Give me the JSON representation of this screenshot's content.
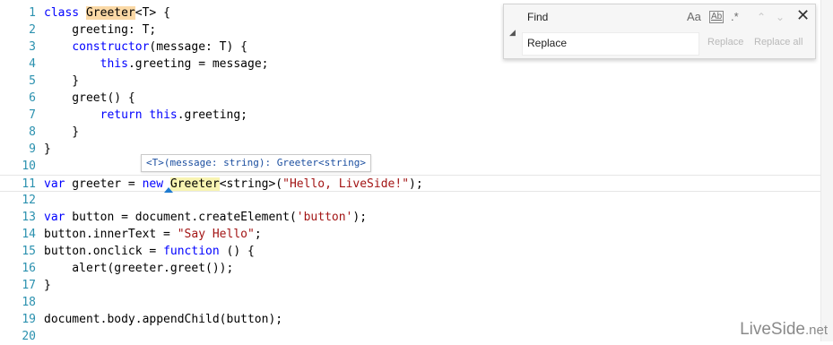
{
  "editor": {
    "lines": [
      {
        "n": "1",
        "segs": [
          {
            "t": "class ",
            "c": "kw"
          },
          {
            "t": "Greeter",
            "c": "hl-ref"
          },
          {
            "t": "<T> {",
            "c": ""
          }
        ]
      },
      {
        "n": "2",
        "segs": [
          {
            "t": "    greeting: T;",
            "c": ""
          }
        ]
      },
      {
        "n": "3",
        "segs": [
          {
            "t": "    ",
            "c": ""
          },
          {
            "t": "constructor",
            "c": "kw"
          },
          {
            "t": "(message: T) {",
            "c": ""
          }
        ]
      },
      {
        "n": "4",
        "segs": [
          {
            "t": "        ",
            "c": ""
          },
          {
            "t": "this",
            "c": "kw"
          },
          {
            "t": ".greeting = message;",
            "c": ""
          }
        ]
      },
      {
        "n": "5",
        "segs": [
          {
            "t": "    }",
            "c": ""
          }
        ]
      },
      {
        "n": "6",
        "segs": [
          {
            "t": "    greet() {",
            "c": ""
          }
        ]
      },
      {
        "n": "7",
        "segs": [
          {
            "t": "        ",
            "c": ""
          },
          {
            "t": "return",
            "c": "kw"
          },
          {
            "t": " ",
            "c": ""
          },
          {
            "t": "this",
            "c": "kw"
          },
          {
            "t": ".greeting;",
            "c": ""
          }
        ]
      },
      {
        "n": "8",
        "segs": [
          {
            "t": "    }",
            "c": ""
          }
        ]
      },
      {
        "n": "9",
        "segs": [
          {
            "t": "}",
            "c": ""
          }
        ]
      },
      {
        "n": "10",
        "segs": []
      },
      {
        "n": "11",
        "segs": [
          {
            "t": "var",
            "c": "kw"
          },
          {
            "t": " greeter = ",
            "c": ""
          },
          {
            "t": "new",
            "c": "kw"
          },
          {
            "t": " ",
            "c": ""
          },
          {
            "t": "Greeter",
            "c": "hl-sel"
          },
          {
            "t": "<string>(",
            "c": ""
          },
          {
            "t": "\"Hello, LiveSide!\"",
            "c": "str"
          },
          {
            "t": ");",
            "c": ""
          }
        ],
        "current": true
      },
      {
        "n": "12",
        "segs": []
      },
      {
        "n": "13",
        "segs": [
          {
            "t": "var",
            "c": "kw"
          },
          {
            "t": " button = document.createElement(",
            "c": ""
          },
          {
            "t": "'button'",
            "c": "str"
          },
          {
            "t": ");",
            "c": ""
          }
        ]
      },
      {
        "n": "14",
        "segs": [
          {
            "t": "button.innerText = ",
            "c": ""
          },
          {
            "t": "\"Say Hello\"",
            "c": "str"
          },
          {
            "t": ";",
            "c": ""
          }
        ]
      },
      {
        "n": "15",
        "segs": [
          {
            "t": "button.onclick = ",
            "c": ""
          },
          {
            "t": "function",
            "c": "kw"
          },
          {
            "t": " () {",
            "c": ""
          }
        ]
      },
      {
        "n": "16",
        "segs": [
          {
            "t": "    alert(greeter.greet());",
            "c": ""
          }
        ]
      },
      {
        "n": "17",
        "segs": [
          {
            "t": "}",
            "c": ""
          }
        ]
      },
      {
        "n": "18",
        "segs": []
      },
      {
        "n": "19",
        "segs": [
          {
            "t": "document.body.appendChild(button);",
            "c": ""
          }
        ]
      },
      {
        "n": "20",
        "segs": []
      }
    ]
  },
  "tooltip": {
    "text": "<T>(message: string): Greeter<string>"
  },
  "find": {
    "find_placeholder": "Find",
    "replace_placeholder": "Replace",
    "match_case_icon": "Aa",
    "whole_word_icon": "Ab",
    "regex_icon": ".*",
    "prev_icon": "^",
    "next_icon": "v",
    "close_icon": "x",
    "replace_label": "Replace",
    "replace_all_label": "Replace all"
  },
  "watermark": {
    "brand": "LiveSide",
    "suffix": ".net"
  },
  "colors": {
    "keyword": "#0000ff",
    "string": "#a31515",
    "line_number": "#2b91af",
    "ref_highlight": "#fbd9a6",
    "selection_highlight": "#f8f4b2",
    "tooltip_text": "#1c4fa0"
  }
}
